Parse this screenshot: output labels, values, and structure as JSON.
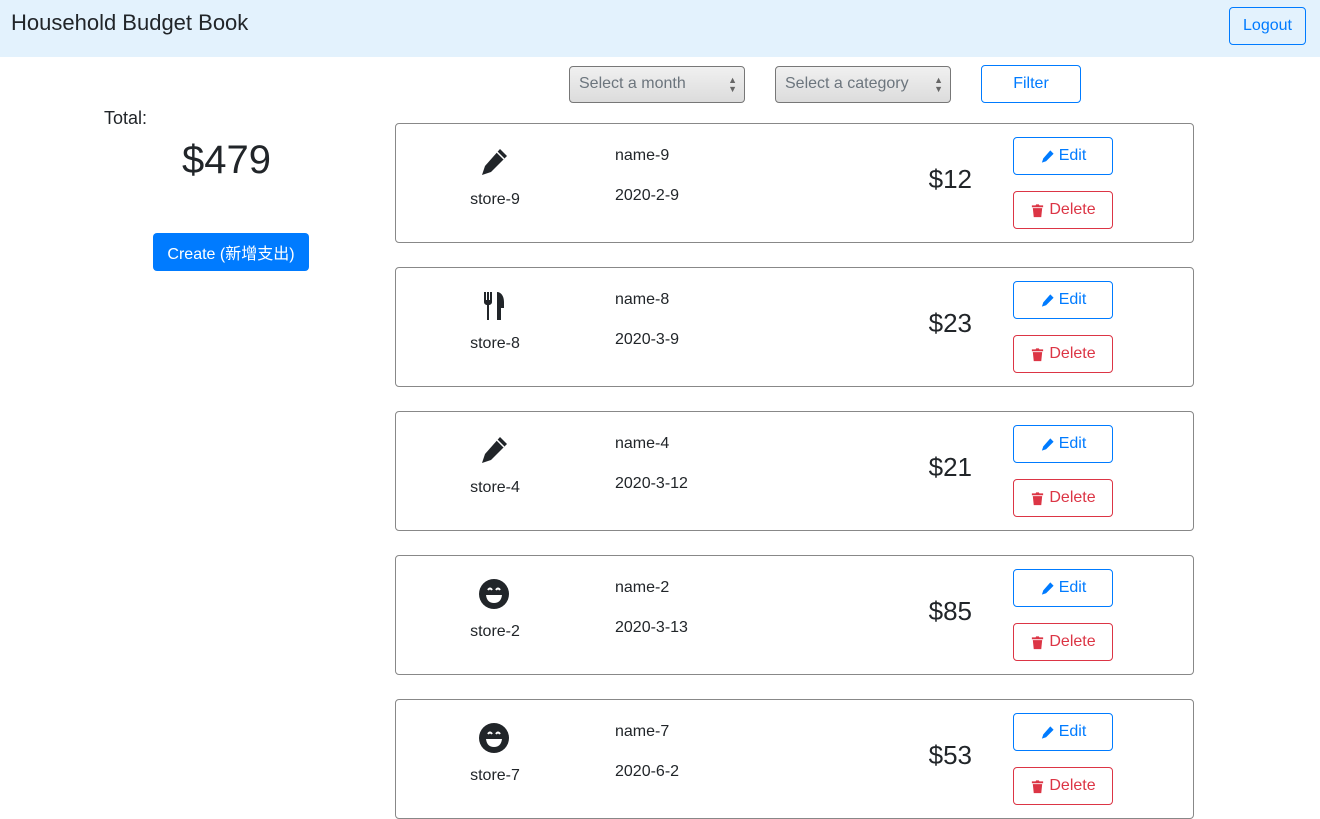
{
  "header": {
    "title": "Household Budget Book",
    "logout_label": "Logout"
  },
  "filters": {
    "month_placeholder": "Select a month",
    "category_placeholder": "Select a category",
    "filter_label": "Filter"
  },
  "summary": {
    "total_label": "Total:",
    "total_value": "$479",
    "create_label": "Create (新增支出)"
  },
  "item_buttons": {
    "edit": "Edit",
    "delete": "Delete"
  },
  "expenses": [
    {
      "icon": "pencil-icon",
      "store": "store-9",
      "name": "name-9",
      "date": "2020-2-9",
      "amount": "$12"
    },
    {
      "icon": "utensils-icon",
      "store": "store-8",
      "name": "name-8",
      "date": "2020-3-9",
      "amount": "$23"
    },
    {
      "icon": "pencil-icon",
      "store": "store-4",
      "name": "name-4",
      "date": "2020-3-12",
      "amount": "$21"
    },
    {
      "icon": "smile-icon",
      "store": "store-2",
      "name": "name-2",
      "date": "2020-3-13",
      "amount": "$85"
    },
    {
      "icon": "smile-icon",
      "store": "store-7",
      "name": "name-7",
      "date": "2020-6-2",
      "amount": "$53"
    }
  ],
  "colors": {
    "primary": "#007bff",
    "danger": "#dc3545",
    "navbar": "#e3f2fd"
  }
}
